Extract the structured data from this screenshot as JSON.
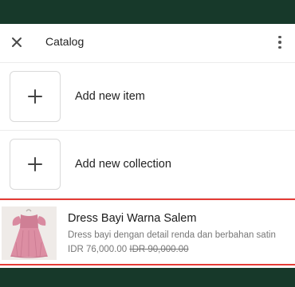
{
  "header": {
    "title": "Catalog",
    "close_icon": "close-icon",
    "more_icon": "more-vertical-icon"
  },
  "actions": [
    {
      "label": "Add new item",
      "icon": "plus-icon"
    },
    {
      "label": "Add new collection",
      "icon": "plus-icon"
    }
  ],
  "product": {
    "name": "Dress Bayi Warna Salem",
    "description": "Dress bayi dengan detail renda dan berbahan satin",
    "price": "IDR 76,000.00",
    "original_price": "IDR 90,000.00"
  },
  "colors": {
    "background": "#17392a",
    "selection_border": "#e53b35",
    "dress": "#d98aa0"
  }
}
